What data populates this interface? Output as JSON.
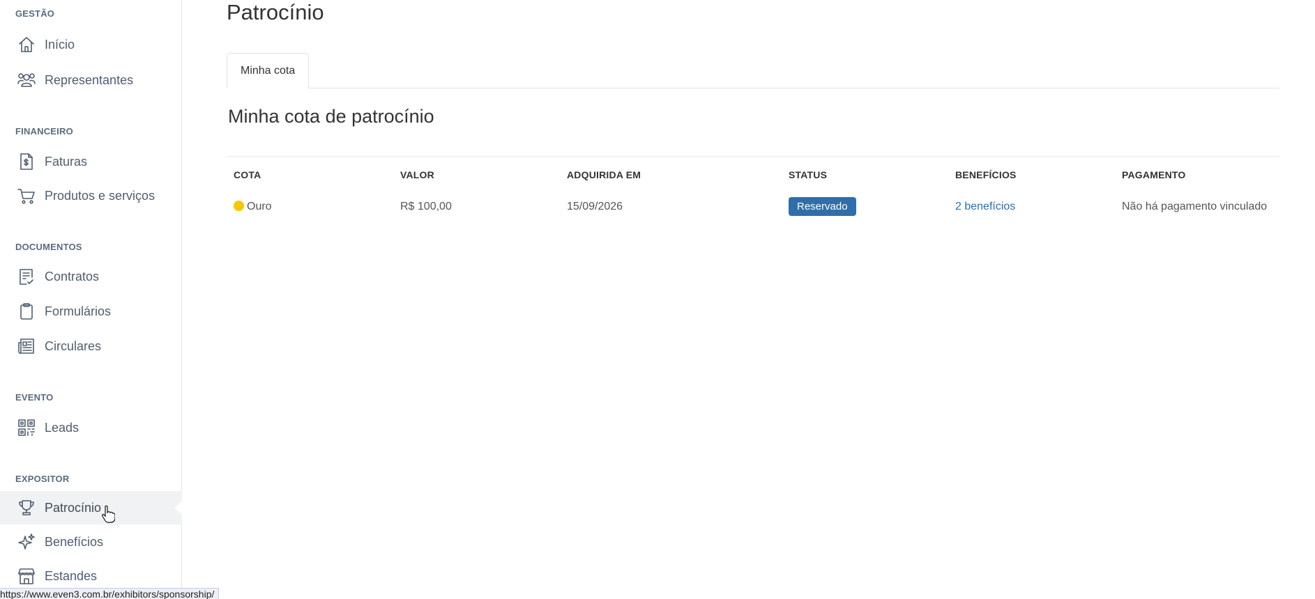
{
  "sidebar": {
    "sections": {
      "gestao": "GESTÃO",
      "financeiro": "FINANCEIRO",
      "documentos": "DOCUMENTOS",
      "evento": "EVENTO",
      "expositor": "EXPOSITOR"
    },
    "items": {
      "inicio": "Início",
      "representantes": "Representantes",
      "faturas": "Faturas",
      "produtos": "Produtos e serviços",
      "contratos": "Contratos",
      "formularios": "Formulários",
      "circulares": "Circulares",
      "leads": "Leads",
      "patrocinio": "Patrocínio",
      "beneficios": "Benefícios",
      "estandes": "Estandes"
    },
    "active": "patrocinio",
    "icons": {
      "inicio": "home-icon",
      "representantes": "users-icon",
      "faturas": "invoice-icon",
      "produtos": "cart-icon",
      "contratos": "contract-icon",
      "formularios": "clipboard-icon",
      "circulares": "newspaper-icon",
      "leads": "qr-code-icon",
      "patrocinio": "trophy-icon",
      "beneficios": "sparkles-icon",
      "estandes": "store-icon"
    }
  },
  "main": {
    "title": "Patrocínio",
    "tabs": [
      {
        "label": "Minha cota"
      }
    ],
    "section_title": "Minha cota de patrocínio",
    "table": {
      "headers": [
        "COTA",
        "VALOR",
        "ADQUIRIDA EM",
        "STATUS",
        "BENEFÍCIOS",
        "PAGAMENTO"
      ],
      "rows": [
        {
          "cota": "Ouro",
          "cota_color": "#f5c800",
          "valor": "R$ 100,00",
          "adquirida_em": "15/09/2026",
          "status": "Reservado",
          "status_color": "#2f6eaa",
          "beneficios": "2 benefícios",
          "pagamento": "Não há pagamento vinculado"
        }
      ]
    }
  },
  "statusbar": {
    "url": "https://www.even3.com.br/exhibitors/sponsorship/"
  }
}
